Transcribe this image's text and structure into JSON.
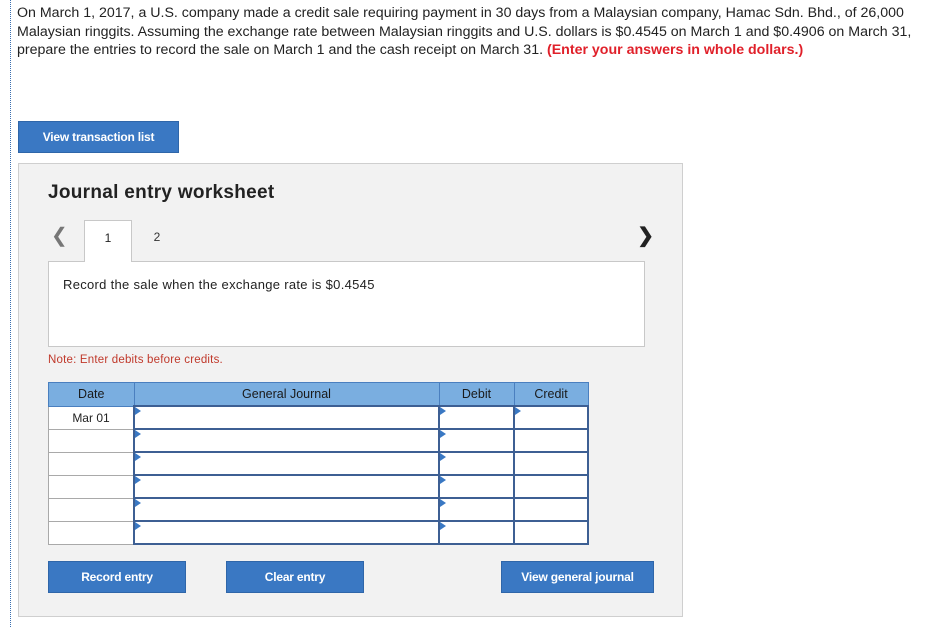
{
  "question": {
    "text": "On March 1, 2017, a U.S. company made a credit sale requiring payment in 30 days from a Malaysian company, Hamac Sdn. Bhd., of 26,000 Malaysian ringgits. Assuming the exchange rate between Malaysian ringgits and U.S. dollars is $0.4545 on March 1 and $0.4906 on March 31, prepare the entries to record the sale on March 1 and the cash receipt on March 31.",
    "emphasis": "(Enter your answers in whole dollars.)"
  },
  "buttons": {
    "view_transaction_list": "View transaction list",
    "record_entry": "Record entry",
    "clear_entry": "Clear entry",
    "view_general_journal": "View general journal"
  },
  "worksheet": {
    "title": "Journal entry worksheet",
    "tabs": [
      "1",
      "2"
    ],
    "active_tab": "1",
    "description": "Record the sale when the exchange rate is $0.4545",
    "note": "Note: Enter debits before credits."
  },
  "journal": {
    "headers": {
      "date": "Date",
      "general_journal": "General Journal",
      "debit": "Debit",
      "credit": "Credit"
    },
    "rows": [
      {
        "date": "Mar 01",
        "account": "",
        "debit": "",
        "credit": ""
      },
      {
        "date": "",
        "account": "",
        "debit": "",
        "credit": ""
      },
      {
        "date": "",
        "account": "",
        "debit": "",
        "credit": ""
      },
      {
        "date": "",
        "account": "",
        "debit": "",
        "credit": ""
      },
      {
        "date": "",
        "account": "",
        "debit": "",
        "credit": ""
      },
      {
        "date": "",
        "account": "",
        "debit": "",
        "credit": ""
      }
    ]
  },
  "colors": {
    "button_blue": "#3a78c3",
    "header_blue": "#7aaee0",
    "emphasis_red": "#e0202a",
    "note_red": "#c0392b"
  },
  "icons": {
    "prev": "chevron-left-icon",
    "next": "chevron-right-icon"
  }
}
